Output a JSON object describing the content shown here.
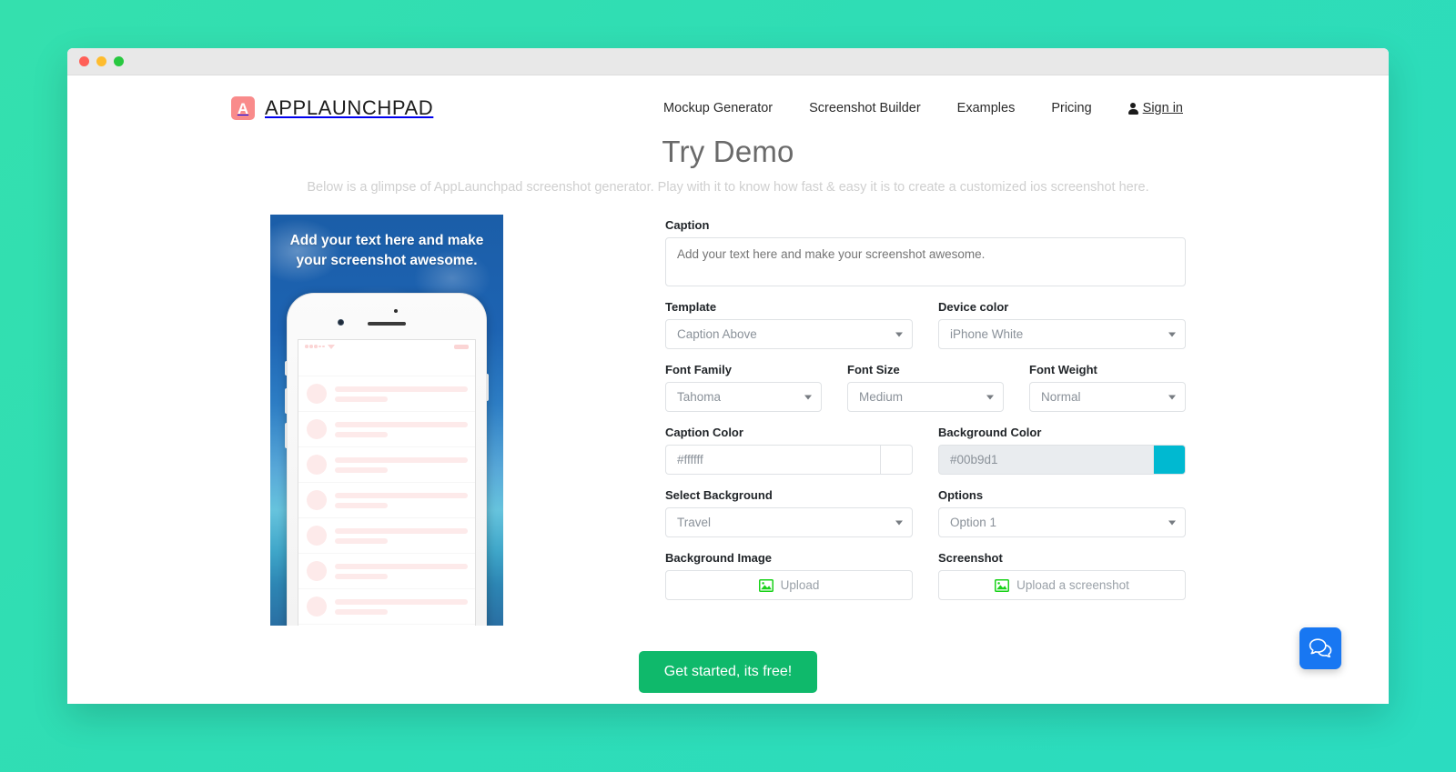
{
  "window": {
    "traffic_lights": [
      "close",
      "minimize",
      "maximize"
    ]
  },
  "header": {
    "brand_initial": "A",
    "brand_name": "APPLAUNCHPAD",
    "brand_color": "#f98b8b",
    "nav": [
      {
        "label": "Mockup Generator"
      },
      {
        "label": "Screenshot Builder"
      },
      {
        "label": "Examples"
      },
      {
        "label": "Pricing"
      }
    ],
    "signin_label": "Sign in"
  },
  "hero": {
    "title": "Try Demo",
    "subtitle": "Below is a glimpse of AppLaunchpad screenshot generator. Play with it to know how fast & easy it is to create a customized ios screenshot here."
  },
  "preview": {
    "caption_text": "Add your text here and make your screenshot awesome.",
    "caption_color": "#ffffff",
    "background_theme": "Travel",
    "device": "iPhone White"
  },
  "form": {
    "caption": {
      "label": "Caption",
      "value": "",
      "placeholder": "Add your text here and make your screenshot awesome."
    },
    "template": {
      "label": "Template",
      "value": "Caption Above"
    },
    "device_color": {
      "label": "Device color",
      "value": "iPhone White"
    },
    "font_family": {
      "label": "Font Family",
      "value": "Tahoma"
    },
    "font_size": {
      "label": "Font Size",
      "value": "Medium"
    },
    "font_weight": {
      "label": "Font Weight",
      "value": "Normal"
    },
    "caption_color": {
      "label": "Caption Color",
      "value": "#ffffff",
      "swatch": "#ffffff"
    },
    "background_color": {
      "label": "Background Color",
      "value": "#00b9d1",
      "swatch": "#00b9d1"
    },
    "select_background": {
      "label": "Select Background",
      "value": "Travel"
    },
    "options": {
      "label": "Options",
      "value": "Option 1"
    },
    "background_image": {
      "label": "Background Image",
      "button_label": "Upload"
    },
    "screenshot": {
      "label": "Screenshot",
      "button_label": "Upload a screenshot"
    }
  },
  "cta": {
    "label": "Get started, its free!",
    "color": "#0fb96b"
  },
  "chat": {
    "icon": "chat-bubbles-icon",
    "color": "#1877f2"
  }
}
